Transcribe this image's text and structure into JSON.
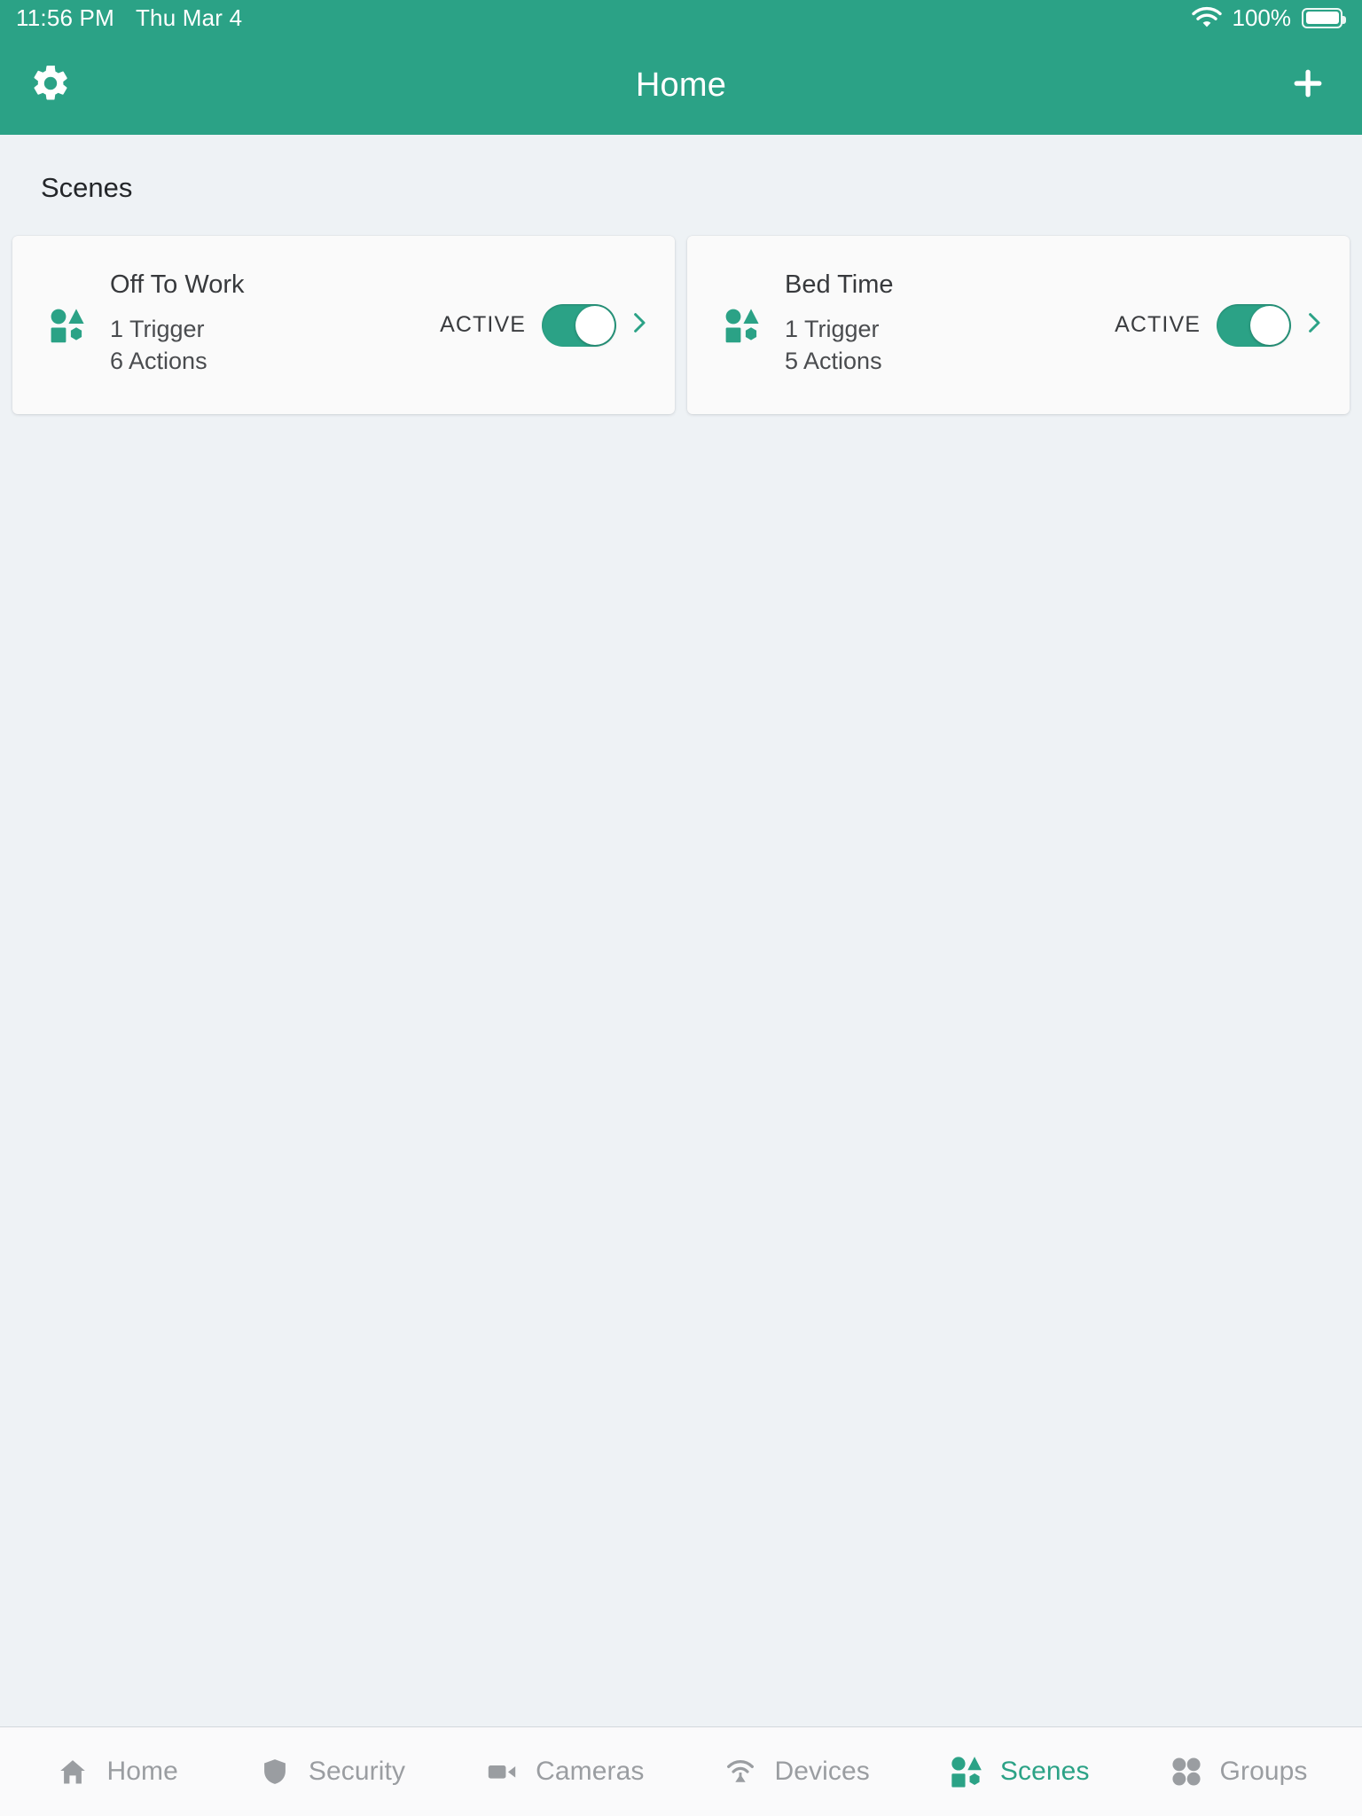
{
  "theme": {
    "accent": "#2ba286",
    "page_bg": "#eef2f5",
    "card_bg": "#fafafa",
    "tabbar_bg": "#fafafb",
    "inactive_gray": "#9a9da1",
    "title_text": "#232629"
  },
  "statusbar": {
    "time": "11:56 PM",
    "date": "Thu Mar 4",
    "wifi_icon": "wifi-icon",
    "battery_percent": "100%",
    "battery_icon": "battery-full-icon"
  },
  "header": {
    "title": "Home",
    "left_icon": "gear-icon",
    "right_icon": "plus-icon"
  },
  "main": {
    "section_title": "Scenes",
    "scenes": [
      {
        "icon": "scenes-shapes-icon",
        "name": "Off To Work",
        "triggers": "1 Trigger",
        "actions": "6 Actions",
        "state_label": "ACTIVE",
        "toggle_on": true,
        "chevron_icon": "chevron-right-icon"
      },
      {
        "icon": "scenes-shapes-icon",
        "name": "Bed Time",
        "triggers": "1 Trigger",
        "actions": "5 Actions",
        "state_label": "ACTIVE",
        "toggle_on": true,
        "chevron_icon": "chevron-right-icon"
      }
    ]
  },
  "tabbar": {
    "items": [
      {
        "label": "Home",
        "icon": "home-icon",
        "active": false
      },
      {
        "label": "Security",
        "icon": "shield-icon",
        "active": false
      },
      {
        "label": "Cameras",
        "icon": "video-camera-icon",
        "active": false
      },
      {
        "label": "Devices",
        "icon": "signal-antenna-icon",
        "active": false
      },
      {
        "label": "Scenes",
        "icon": "scenes-shapes-icon",
        "active": true
      },
      {
        "label": "Groups",
        "icon": "four-dots-icon",
        "active": false
      }
    ]
  }
}
